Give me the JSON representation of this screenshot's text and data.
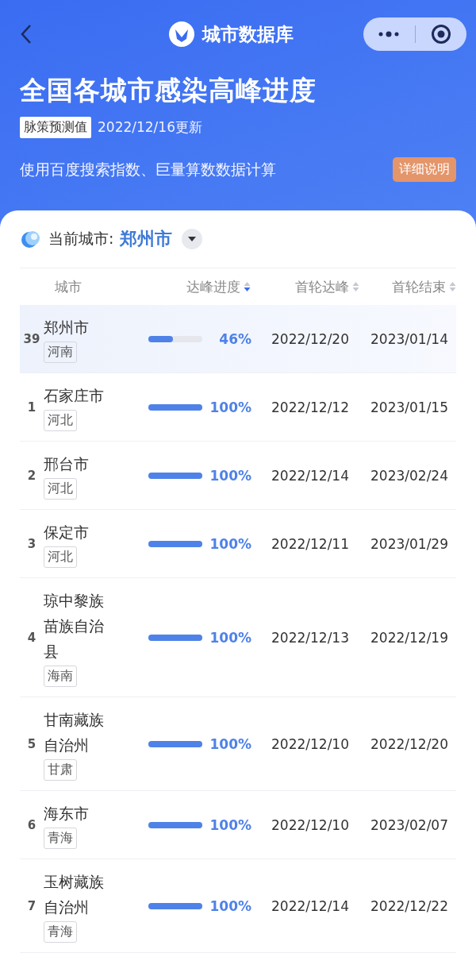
{
  "nav": {
    "title": "城市数据库"
  },
  "header": {
    "title": "全国各城市感染高峰进度",
    "badge": "脉策预测值",
    "updated": "2022/12/16更新",
    "description": "使用百度搜索指数、巨量算数数据计算",
    "detail_button": "详细说明"
  },
  "city_selector": {
    "label": "当前城市:",
    "value": "郑州市"
  },
  "table": {
    "columns": [
      {
        "label": "城市",
        "kind": "plain"
      },
      {
        "label": "达峰进度",
        "kind": "sortable",
        "sorted": true
      },
      {
        "label": "首轮达峰",
        "kind": "sortable",
        "sorted": false
      },
      {
        "label": "首轮结束",
        "kind": "sortable",
        "sorted": false
      }
    ],
    "rows": [
      {
        "rank": "39",
        "city": "郑州市",
        "province": "河南",
        "level": 0.46,
        "progress": "46%",
        "peak": "2022/12/20",
        "end": "2023/01/14",
        "selected": true
      },
      {
        "rank": "1",
        "city": "石家庄市",
        "province": "河北",
        "level": 1,
        "progress": "100%",
        "peak": "2022/12/12",
        "end": "2023/01/15",
        "selected": false
      },
      {
        "rank": "2",
        "city": "邢台市",
        "province": "河北",
        "level": 1,
        "progress": "100%",
        "peak": "2022/12/14",
        "end": "2023/02/24",
        "selected": false
      },
      {
        "rank": "3",
        "city": "保定市",
        "province": "河北",
        "level": 1,
        "progress": "100%",
        "peak": "2022/12/11",
        "end": "2023/01/29",
        "selected": false
      },
      {
        "rank": "4",
        "city": "琼中黎族苗族自治县",
        "province": "海南",
        "level": 1,
        "progress": "100%",
        "peak": "2022/12/13",
        "end": "2022/12/19",
        "selected": false
      },
      {
        "rank": "5",
        "city": "甘南藏族自治州",
        "province": "甘肃",
        "level": 1,
        "progress": "100%",
        "peak": "2022/12/10",
        "end": "2022/12/20",
        "selected": false
      },
      {
        "rank": "6",
        "city": "海东市",
        "province": "青海",
        "level": 1,
        "progress": "100%",
        "peak": "2022/12/10",
        "end": "2023/02/07",
        "selected": false
      },
      {
        "rank": "7",
        "city": "玉树藏族自治州",
        "province": "青海",
        "level": 1,
        "progress": "100%",
        "peak": "2022/12/14",
        "end": "2022/12/22",
        "selected": false
      }
    ]
  }
}
